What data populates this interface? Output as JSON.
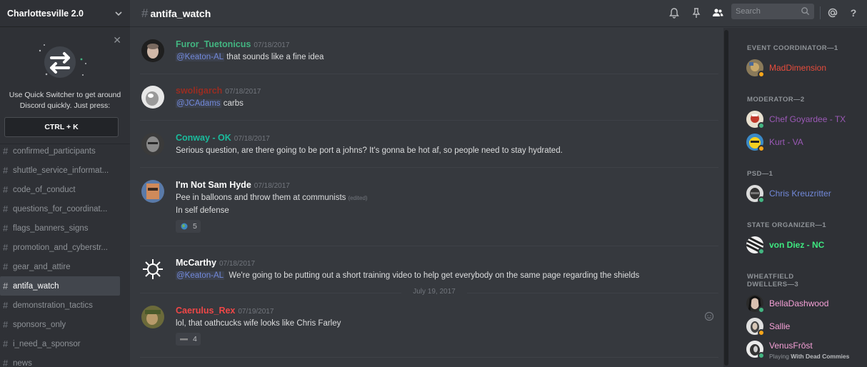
{
  "server": {
    "name": "Charlottesville 2.0"
  },
  "quick_switcher": {
    "text": "Use Quick Switcher to get around Discord quickly. Just press:",
    "shortcut": "CTRL + K"
  },
  "channels": [
    {
      "name": "confirmed_participants",
      "active": false
    },
    {
      "name": "shuttle_service_informat...",
      "active": false
    },
    {
      "name": "code_of_conduct",
      "active": false
    },
    {
      "name": "questions_for_coordinat...",
      "active": false
    },
    {
      "name": "flags_banners_signs",
      "active": false
    },
    {
      "name": "promotion_and_cyberstr...",
      "active": false
    },
    {
      "name": "gear_and_attire",
      "active": false
    },
    {
      "name": "antifa_watch",
      "active": true
    },
    {
      "name": "demonstration_tactics",
      "active": false
    },
    {
      "name": "sponsors_only",
      "active": false
    },
    {
      "name": "i_need_a_sponsor",
      "active": false
    },
    {
      "name": "news",
      "active": false
    }
  ],
  "header": {
    "channel_name": "antifa_watch",
    "search_placeholder": "Search",
    "icons": [
      "bell-icon",
      "pin-icon",
      "members-icon",
      "search-icon",
      "mention-icon",
      "help-icon"
    ]
  },
  "messages": [
    {
      "author": "Furor_Tuetonicus",
      "color": "#43b581",
      "timestamp": "07/18/2017",
      "mention": "@Keaton-AL",
      "text": "that sounds like a fine idea"
    },
    {
      "author": "swoligarch",
      "color": "#992d22",
      "timestamp": "07/18/2017",
      "mention": "@JCAdams",
      "text": "carbs"
    },
    {
      "author": "Conway - OK",
      "color": "#1abc9c",
      "timestamp": "07/18/2017",
      "text": "Serious question, are there going to be port a johns? It's gonna be hot af, so people need to stay hydrated."
    },
    {
      "author": "I'm Not Sam Hyde",
      "color": "#ffffff",
      "timestamp": "07/18/2017",
      "text": "Pee in balloons and throw them at communists",
      "edited": "(edited)",
      "text2": "In self defense",
      "reaction_count": "5"
    },
    {
      "author": "McCarthy",
      "color": "#ffffff",
      "timestamp": "07/18/2017",
      "mention": "@Keaton-AL",
      "text": "We're going to be putting out a short training video to help get everybody on the same page regarding the shields"
    },
    {
      "author": "Caerulus_Rex",
      "color": "#f04747",
      "timestamp": "07/19/2017",
      "text": "lol, that oathcucks wife looks like Chris Farley",
      "reaction_count": "4"
    }
  ],
  "date_divider": "July 19, 2017",
  "member_groups": [
    {
      "title": "EVENT COORDINATOR—1",
      "members": [
        {
          "name": "MadDimension",
          "color": "#e74c3c",
          "status": "#faa61a"
        }
      ]
    },
    {
      "title": "MODERATOR—2",
      "members": [
        {
          "name": "Chef Goyardee - TX",
          "color": "#9b59b6",
          "status": "#43b581"
        },
        {
          "name": "Kurt - VA",
          "color": "#9b59b6",
          "status": "#faa61a"
        }
      ]
    },
    {
      "title": "PSD—1",
      "members": [
        {
          "name": "Chris Kreuzritter",
          "color": "#7289da",
          "status": "#43b581"
        }
      ]
    },
    {
      "title": "STATE ORGANIZER—1",
      "members": [
        {
          "name": "von Diez - NC",
          "color": "#3ee880",
          "status": "#43b581"
        }
      ]
    },
    {
      "title": "WHEATFIELD DWELLERS—3",
      "members": [
        {
          "name": "BellaDashwood",
          "color": "#f5a0d6",
          "status": "#43b581"
        },
        {
          "name": "Sallie",
          "color": "#f5a0d6",
          "status": "#faa61a"
        },
        {
          "name": "VenusFrōst",
          "color": "#f5a0d6",
          "status": "#43b581",
          "activity_prefix": "Playing",
          "activity": "With Dead Commies"
        }
      ]
    }
  ]
}
